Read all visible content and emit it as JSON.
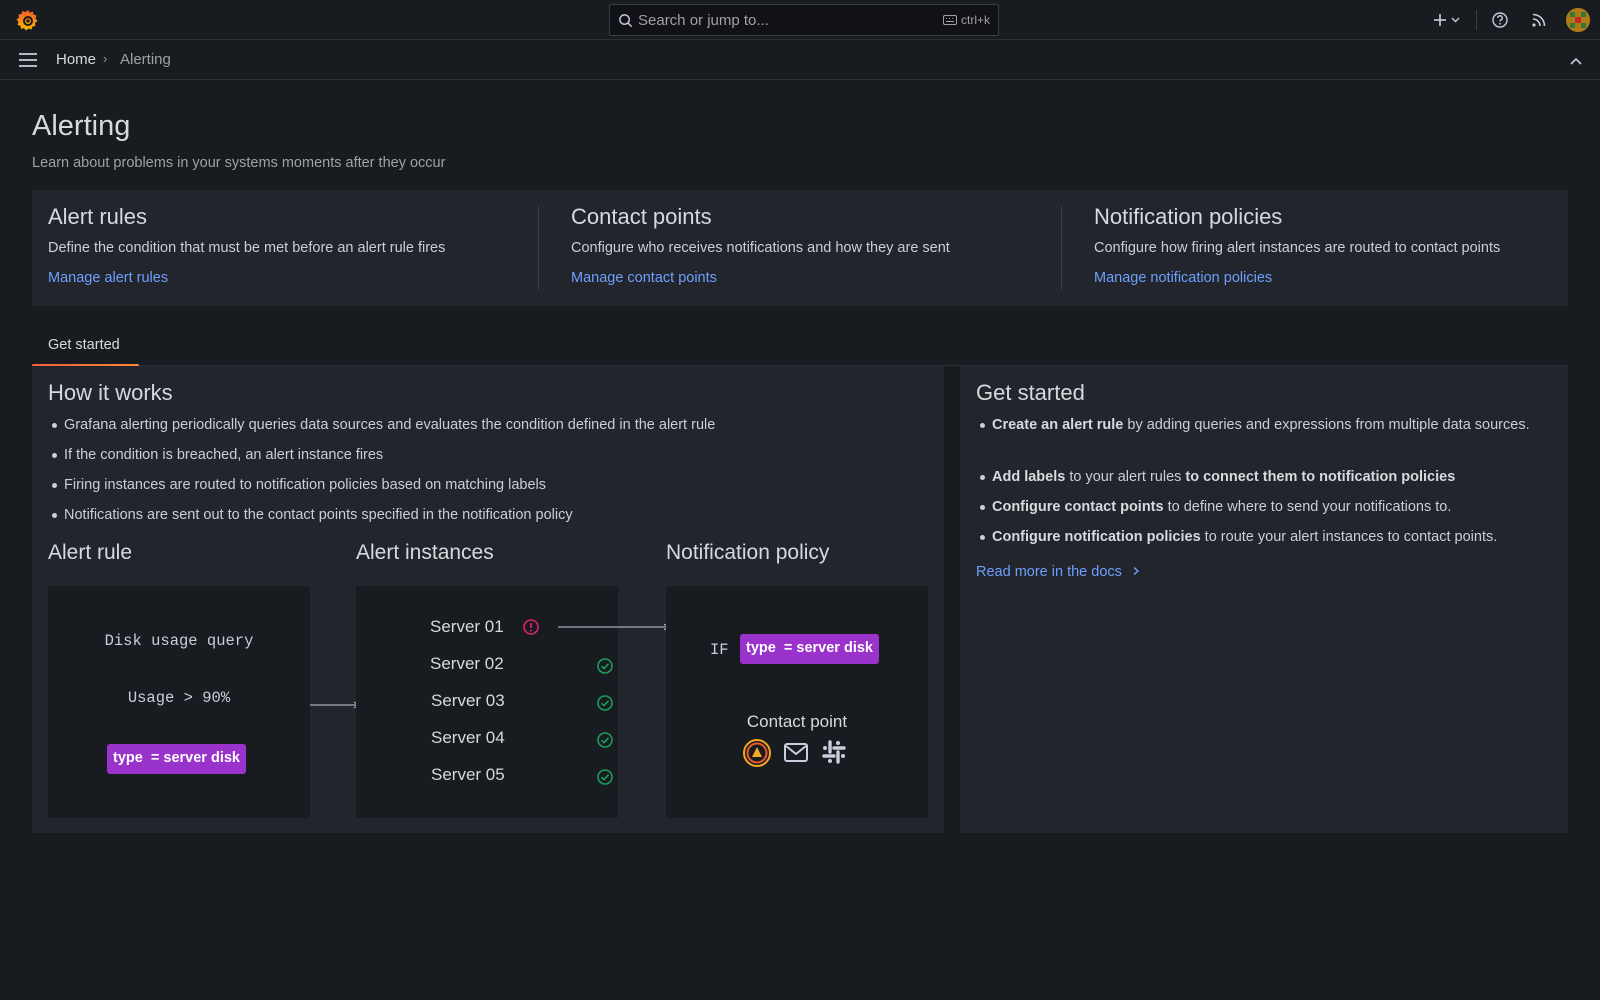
{
  "topbar": {
    "search_placeholder": "Search or jump to...",
    "search_shortcut": "ctrl+k"
  },
  "breadcrumb": {
    "home": "Home",
    "separator": "›",
    "current": "Alerting"
  },
  "page": {
    "title": "Alerting",
    "subtitle": "Learn about problems in your systems moments after they occur"
  },
  "cards": [
    {
      "title": "Alert rules",
      "description": "Define the condition that must be met before an alert rule fires",
      "link": "Manage alert rules"
    },
    {
      "title": "Contact points",
      "description": "Configure who receives notifications and how they are sent",
      "link": "Manage contact points"
    },
    {
      "title": "Notification policies",
      "description": "Configure how firing alert instances are routed to contact points",
      "link": "Manage notification policies"
    }
  ],
  "tabs": [
    {
      "label": "Get started",
      "active": true
    }
  ],
  "how_it_works": {
    "title": "How it works",
    "bullets": [
      "Grafana alerting periodically queries data sources and evaluates the condition defined in the alert rule",
      "If the condition is breached, an alert instance fires",
      "Firing instances are routed to notification policies based on matching labels",
      "Notifications are sent out to the contact points specified in the notification policy"
    ],
    "diagram": {
      "alert_rule": {
        "title": "Alert rule",
        "query": "Disk usage query",
        "condition": "Usage > 90%",
        "label_key": "type",
        "label_op": "=",
        "label_value": "server disk"
      },
      "alert_instances": {
        "title": "Alert instances",
        "servers": [
          {
            "name": "Server 01",
            "status": "firing"
          },
          {
            "name": "Server 02",
            "status": "ok"
          },
          {
            "name": "Server 03",
            "status": "ok"
          },
          {
            "name": "Server 04",
            "status": "ok"
          },
          {
            "name": "Server 05",
            "status": "ok"
          }
        ]
      },
      "notification_policy": {
        "title": "Notification policy",
        "if_text": "IF",
        "label_key": "type",
        "label_op": "=",
        "label_value": "server disk",
        "contact_point_title": "Contact point",
        "contact_icons": [
          "grafana-oncall-icon",
          "email-icon",
          "slack-icon"
        ]
      }
    }
  },
  "get_started": {
    "title": "Get started",
    "bullets": [
      {
        "bold": "Create an alert rule",
        "rest": " by adding queries and expressions from multiple data sources."
      },
      {
        "bold": "Add labels",
        "rest": " to your alert rules ",
        "bold2": "to connect them to notification policies"
      },
      {
        "bold": "Configure contact points",
        "rest": " to define where to send your notifications to."
      },
      {
        "bold": "Configure notification policies",
        "rest": " to route your alert instances to contact points."
      }
    ],
    "docs_link": "Read more in the docs"
  },
  "colors": {
    "background": "#181b1f",
    "panel": "#22252b",
    "link": "#6e9fff",
    "label_chip": "#9933cc",
    "firing": "#e0226e",
    "ok": "#1a9e5c",
    "tab_accent": "#f55f3e"
  }
}
